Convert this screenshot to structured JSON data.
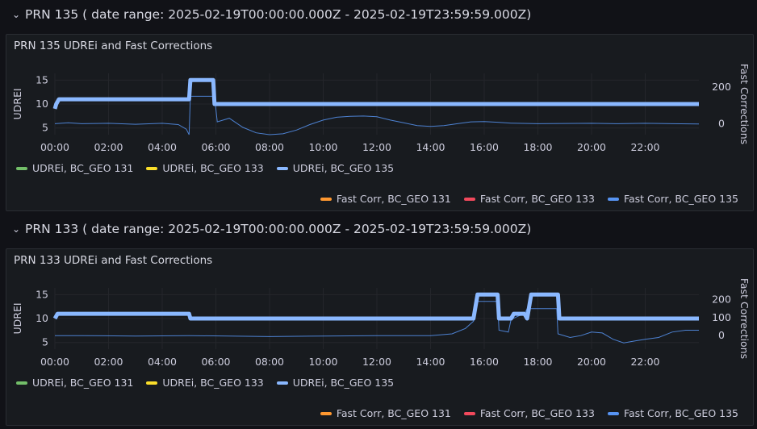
{
  "rows": [
    {
      "header": "PRN 135 ( date range: 2025-02-19T00:00:00.000Z - 2025-02-19T23:59:59.000Z)",
      "panel_title": "PRN 135 UDREi and Fast Corrections"
    },
    {
      "header": "PRN 133 ( date range: 2025-02-19T00:00:00.000Z - 2025-02-19T23:59:59.000Z)",
      "panel_title": "PRN 133 UDREi and Fast Corrections"
    }
  ],
  "legend_left": [
    "UDREi, BC_GEO 131",
    "UDREi, BC_GEO 133",
    "UDREi, BC_GEO 135"
  ],
  "legend_right": [
    "Fast Corr, BC_GEO 131",
    "Fast Corr, BC_GEO 133",
    "Fast Corr, BC_GEO 135"
  ],
  "colors": {
    "geo131_udrei": "#73bf69",
    "geo133_udrei": "#fade2a",
    "geo135_udrei": "#8ab8ff",
    "geo131_fc": "#ff9830",
    "geo133_fc": "#f2495c",
    "geo135_fc": "#5794f2"
  },
  "chart_data": [
    {
      "type": "line",
      "title": "PRN 135 UDREi and Fast Corrections",
      "ylabel": "UDREI",
      "y2label": "Fast Corrections",
      "x_ticks": [
        "00:00",
        "02:00",
        "04:00",
        "06:00",
        "08:00",
        "10:00",
        "12:00",
        "14:00",
        "16:00",
        "18:00",
        "20:00",
        "22:00"
      ],
      "y_ticks": [
        5,
        10,
        15
      ],
      "y2_ticks": [
        0,
        200
      ],
      "ylim": [
        3.6,
        16.4
      ],
      "y2lim": [
        -60,
        275
      ],
      "xlim_hours": [
        0,
        24
      ],
      "udrei": [
        [
          0,
          9
        ],
        [
          0.05,
          10
        ],
        [
          0.15,
          11
        ],
        [
          5.0,
          11
        ],
        [
          5.05,
          15
        ],
        [
          5.9,
          15
        ],
        [
          5.95,
          10
        ],
        [
          24,
          10
        ]
      ],
      "fast_corr": [
        [
          0,
          0
        ],
        [
          0.5,
          5
        ],
        [
          1.0,
          0
        ],
        [
          2.0,
          2
        ],
        [
          3.0,
          -3
        ],
        [
          4.0,
          2
        ],
        [
          4.6,
          -5
        ],
        [
          4.9,
          -30
        ],
        [
          5.0,
          -60
        ],
        [
          5.05,
          150
        ],
        [
          5.95,
          150
        ],
        [
          6.05,
          10
        ],
        [
          6.5,
          30
        ],
        [
          7.0,
          -20
        ],
        [
          7.5,
          -50
        ],
        [
          8.0,
          -60
        ],
        [
          8.5,
          -55
        ],
        [
          9.0,
          -35
        ],
        [
          9.5,
          -5
        ],
        [
          10.0,
          20
        ],
        [
          10.5,
          35
        ],
        [
          11.0,
          40
        ],
        [
          11.5,
          42
        ],
        [
          12.0,
          38
        ],
        [
          12.5,
          20
        ],
        [
          13.0,
          5
        ],
        [
          13.5,
          -10
        ],
        [
          14.0,
          -15
        ],
        [
          14.5,
          -10
        ],
        [
          15.0,
          0
        ],
        [
          15.5,
          10
        ],
        [
          16.0,
          12
        ],
        [
          16.5,
          8
        ],
        [
          17.0,
          3
        ],
        [
          18.0,
          0
        ],
        [
          20.0,
          2
        ],
        [
          21.0,
          0
        ],
        [
          22.0,
          2
        ],
        [
          23.0,
          0
        ],
        [
          24,
          -2
        ]
      ]
    },
    {
      "type": "line",
      "title": "PRN 133 UDREi and Fast Corrections",
      "ylabel": "UDREI",
      "y2label": "Fast Corrections",
      "x_ticks": [
        "00:00",
        "02:00",
        "04:00",
        "06:00",
        "08:00",
        "10:00",
        "12:00",
        "14:00",
        "16:00",
        "18:00",
        "20:00",
        "22:00"
      ],
      "y_ticks": [
        5,
        10,
        15
      ],
      "y2_ticks": [
        0,
        100,
        200
      ],
      "ylim": [
        3.6,
        16.4
      ],
      "y2lim": [
        -75,
        265
      ],
      "xlim_hours": [
        0,
        24
      ],
      "udrei": [
        [
          0,
          10
        ],
        [
          0.1,
          11
        ],
        [
          5.0,
          11
        ],
        [
          5.05,
          10
        ],
        [
          15.6,
          10
        ],
        [
          15.75,
          15
        ],
        [
          16.5,
          15
        ],
        [
          16.55,
          10
        ],
        [
          17.0,
          10
        ],
        [
          17.1,
          11
        ],
        [
          17.5,
          11
        ],
        [
          17.6,
          10
        ],
        [
          17.75,
          15
        ],
        [
          18.75,
          15
        ],
        [
          18.8,
          10
        ],
        [
          24,
          10
        ]
      ],
      "fast_corr": [
        [
          0,
          0
        ],
        [
          1.0,
          0
        ],
        [
          3.0,
          -2
        ],
        [
          5.0,
          0
        ],
        [
          8.0,
          -5
        ],
        [
          10.0,
          -2
        ],
        [
          12.0,
          0
        ],
        [
          14.0,
          0
        ],
        [
          14.8,
          10
        ],
        [
          15.3,
          40
        ],
        [
          15.6,
          80
        ],
        [
          15.75,
          190
        ],
        [
          16.5,
          190
        ],
        [
          16.55,
          30
        ],
        [
          16.9,
          20
        ],
        [
          17.0,
          90
        ],
        [
          17.3,
          110
        ],
        [
          17.5,
          120
        ],
        [
          17.6,
          150
        ],
        [
          18.7,
          150
        ],
        [
          18.75,
          10
        ],
        [
          19.2,
          -10
        ],
        [
          19.6,
          0
        ],
        [
          20.0,
          20
        ],
        [
          20.4,
          15
        ],
        [
          20.8,
          -20
        ],
        [
          21.2,
          -40
        ],
        [
          21.6,
          -30
        ],
        [
          22.0,
          -20
        ],
        [
          22.5,
          -10
        ],
        [
          23.0,
          20
        ],
        [
          23.5,
          30
        ],
        [
          24,
          30
        ]
      ]
    }
  ]
}
